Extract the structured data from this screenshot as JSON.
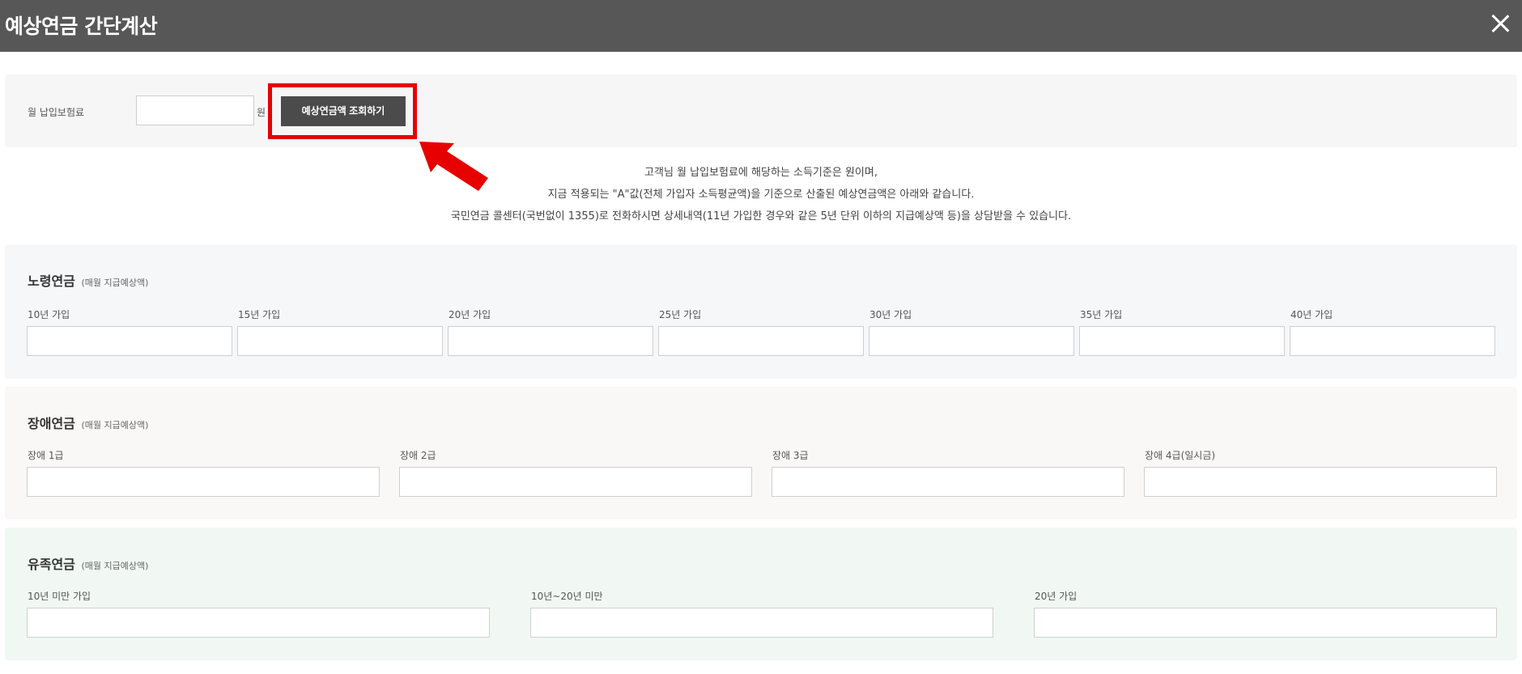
{
  "window": {
    "title": "예상연금 간단계산",
    "close_icon": "close-icon"
  },
  "query": {
    "label": "월 납입보험료",
    "input_value": "",
    "unit": "원",
    "button_label": "예상연금액 조회하기"
  },
  "highlight": {
    "color": "#e60000"
  },
  "notice": {
    "line1": "고객님 월 납입보험료에 해당하는 소득기준은 원이며,",
    "line2": "지금 적용되는 \"A\"값(전체 가입자 소득평균액)을 기준으로 산출된 예상연금액은 아래와 같습니다.",
    "line3": "국민연금 콜센터(국번없이 1355)로 전화하시면 상세내역(11년 가입한 경우와 같은 5년 단위 이하의 지급예상액 등)을 상담받을 수 있습니다."
  },
  "old_age": {
    "title": "노령연금",
    "subtitle": "(매월 지급예상액)",
    "fields": [
      {
        "label": "10년 가입",
        "value": ""
      },
      {
        "label": "15년 가입",
        "value": ""
      },
      {
        "label": "20년 가입",
        "value": ""
      },
      {
        "label": "25년 가입",
        "value": ""
      },
      {
        "label": "30년 가입",
        "value": ""
      },
      {
        "label": "35년 가입",
        "value": ""
      },
      {
        "label": "40년 가입",
        "value": ""
      }
    ]
  },
  "disability": {
    "title": "장애연금",
    "subtitle": "(매월 지급예상액)",
    "fields": [
      {
        "label": "장애 1급",
        "value": ""
      },
      {
        "label": "장애 2급",
        "value": ""
      },
      {
        "label": "장애 3급",
        "value": ""
      },
      {
        "label": "장애 4급(일시금)",
        "value": ""
      }
    ]
  },
  "survivor": {
    "title": "유족연금",
    "subtitle": "(매월 지급예상액)",
    "fields": [
      {
        "label": "10년 미만 가입",
        "value": ""
      },
      {
        "label": "10년~20년 미만",
        "value": ""
      },
      {
        "label": "20년 가입",
        "value": ""
      }
    ]
  }
}
